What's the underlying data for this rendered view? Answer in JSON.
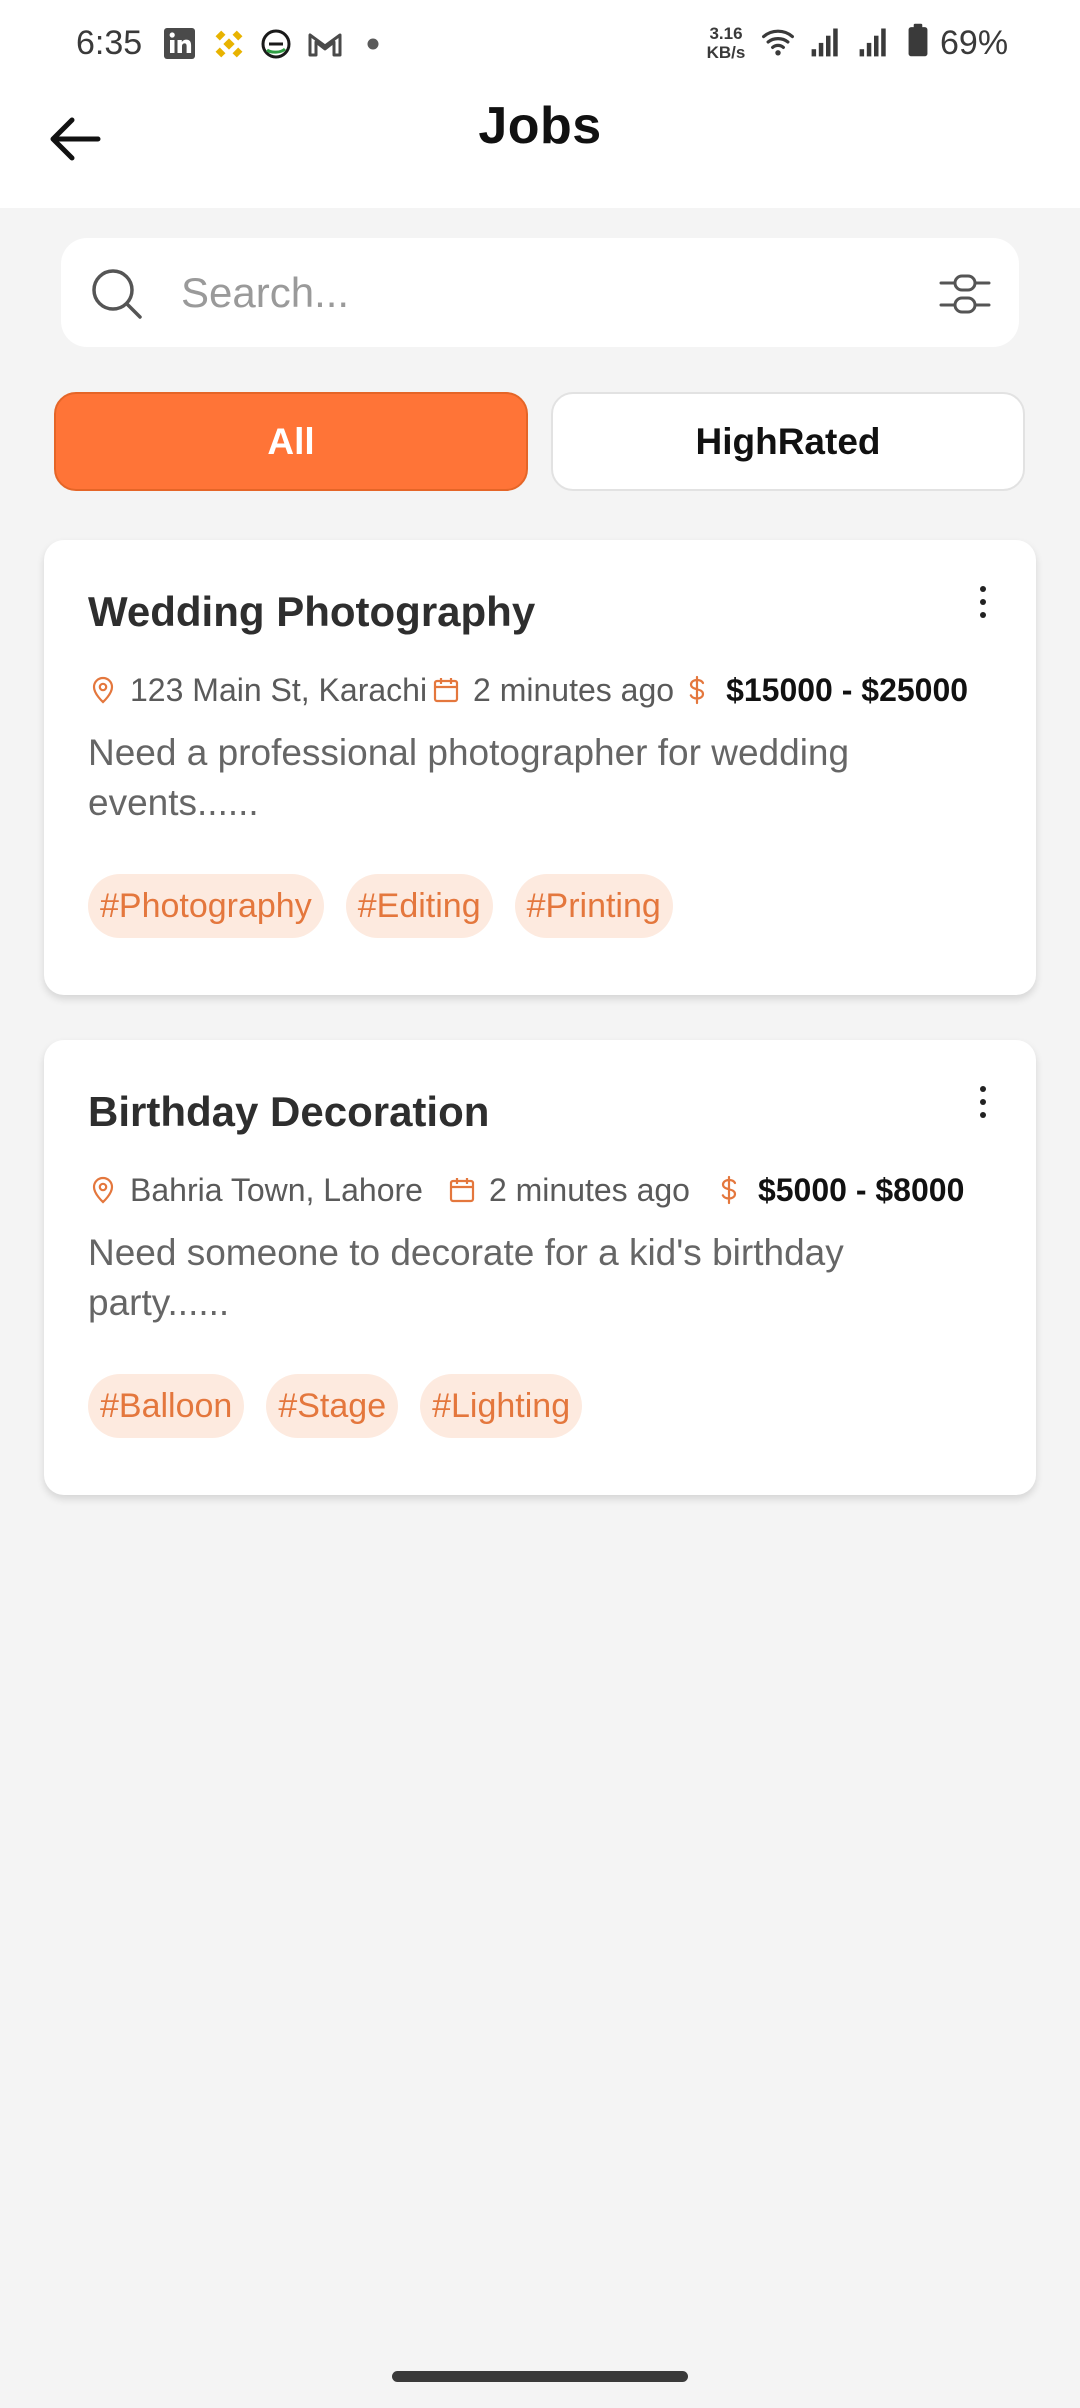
{
  "status_bar": {
    "time": "6:35",
    "net_speed_value": "3.16",
    "net_speed_unit": "KB/s",
    "battery": "69%",
    "notification_icons": [
      "linkedin-icon",
      "binance-icon",
      "app-e-icon",
      "gmail-icon",
      "more-dot-icon"
    ],
    "system_icons": [
      "wifi-icon",
      "signal-icon",
      "signal-icon",
      "battery-icon"
    ]
  },
  "header": {
    "title": "Jobs",
    "back_icon": "arrow-left-icon"
  },
  "search": {
    "placeholder": "Search...",
    "value": "",
    "icon": "search-icon",
    "filter_icon": "filter-sliders-icon"
  },
  "tabs": [
    {
      "label": "All",
      "active": true
    },
    {
      "label": "HighRated",
      "active": false
    }
  ],
  "jobs": [
    {
      "title": "Wedding Photography",
      "location": "123 Main St, Karachi",
      "posted": "2 minutes ago",
      "price": "$15000 - $25000",
      "description": "Need a professional photographer for wedding events......",
      "tags": [
        "#Photography",
        "#Editing",
        "#Printing"
      ]
    },
    {
      "title": "Birthday Decoration",
      "location": "Bahria Town, Lahore",
      "posted": "2 minutes ago",
      "price": "$5000 - $8000",
      "description": "Need someone to decorate for a kid's birthday party......",
      "tags": [
        "#Balloon",
        "#Stage",
        "#Lighting"
      ]
    }
  ],
  "colors": {
    "accent": "#ff7437",
    "tag_bg": "#fdeadf",
    "tag_text": "#e4773d",
    "background": "#f4f4f4"
  }
}
